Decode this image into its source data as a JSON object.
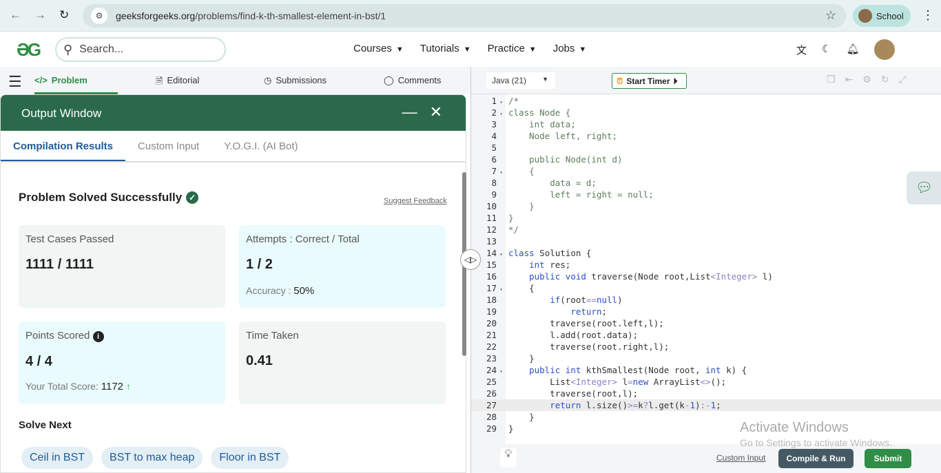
{
  "browser": {
    "url_domain": "geeksforgeeks.org",
    "url_path": "/problems/find-k-th-smallest-element-in-bst/1",
    "profile": "School"
  },
  "site": {
    "logo": "GfG",
    "search_placeholder": "Search...",
    "nav": [
      "Courses",
      "Tutorials",
      "Practice",
      "Jobs"
    ]
  },
  "left_tabs": [
    "Problem",
    "Editorial",
    "Submissions",
    "Comments"
  ],
  "output": {
    "title": "Output Window",
    "tabs": [
      "Compilation Results",
      "Custom Input",
      "Y.O.G.I. (AI Bot)"
    ],
    "status": "Problem Solved Successfully",
    "suggest": "Suggest Feedback",
    "test_label": "Test Cases Passed",
    "test_value": "1111 / 1111",
    "attempts_label": "Attempts : Correct / Total",
    "attempts_value": "1 / 2",
    "accuracy_label": "Accuracy :",
    "accuracy_value": "50%",
    "points_label": "Points Scored",
    "points_value": "4 / 4",
    "total_label": "Your Total Score:",
    "total_value": "1172",
    "time_label": "Time Taken",
    "time_value": "0.41",
    "solve_next": "Solve Next",
    "next": [
      "Ceil in BST",
      "BST to max heap",
      "Floor in BST"
    ]
  },
  "editor": {
    "language": "Java (21)",
    "timer": "Start Timer",
    "current_line": 27,
    "folds": [
      1,
      2,
      7,
      14,
      17,
      24
    ],
    "lines": [
      [
        [
          "cm",
          "/*"
        ]
      ],
      [
        [
          "cm",
          "class Node {"
        ]
      ],
      [
        [
          "cm",
          "    int data;"
        ]
      ],
      [
        [
          "cm",
          "    Node left, right;"
        ]
      ],
      [],
      [
        [
          "cm",
          "    public Node(int d)"
        ]
      ],
      [
        [
          "cm",
          "    {"
        ]
      ],
      [
        [
          "cm",
          "        data = d;"
        ]
      ],
      [
        [
          "cm",
          "        left = right = null;"
        ]
      ],
      [
        [
          "cm",
          "    }"
        ]
      ],
      [
        [
          "cm",
          "}"
        ]
      ],
      [
        [
          "cm",
          "*/"
        ]
      ],
      [],
      [
        [
          "kw",
          "class"
        ],
        [
          "pl",
          " Solution {"
        ]
      ],
      [
        [
          "pl",
          "    "
        ],
        [
          "kw",
          "int"
        ],
        [
          "pl",
          " res;"
        ]
      ],
      [
        [
          "pl",
          "    "
        ],
        [
          "kw",
          "public void"
        ],
        [
          "pl",
          " traverse(Node root,List"
        ],
        [
          "op",
          "<Integer>"
        ],
        [
          "pl",
          " l)"
        ]
      ],
      [
        [
          "pl",
          "    {"
        ]
      ],
      [
        [
          "pl",
          "        "
        ],
        [
          "kw",
          "if"
        ],
        [
          "pl",
          "(root"
        ],
        [
          "op",
          "=="
        ],
        [
          "kw",
          "null"
        ],
        [
          "pl",
          ")"
        ]
      ],
      [
        [
          "pl",
          "            "
        ],
        [
          "kw",
          "return"
        ],
        [
          "pl",
          ";"
        ]
      ],
      [
        [
          "pl",
          "        traverse(root.left,l);"
        ]
      ],
      [
        [
          "pl",
          "        l.add(root.data);"
        ]
      ],
      [
        [
          "pl",
          "        traverse(root.right,l);"
        ]
      ],
      [
        [
          "pl",
          "    }"
        ]
      ],
      [
        [
          "pl",
          "    "
        ],
        [
          "kw",
          "public int"
        ],
        [
          "pl",
          " kthSmallest(Node root, "
        ],
        [
          "kw",
          "int"
        ],
        [
          "pl",
          " k) {"
        ]
      ],
      [
        [
          "pl",
          "        List"
        ],
        [
          "op",
          "<Integer>"
        ],
        [
          "pl",
          " l"
        ],
        [
          "op",
          "="
        ],
        [
          "kw",
          "new"
        ],
        [
          "pl",
          " ArrayList"
        ],
        [
          "op",
          "<>"
        ],
        [
          "pl",
          "();"
        ]
      ],
      [
        [
          "pl",
          "        traverse(root,l);"
        ]
      ],
      [
        [
          "pl",
          "        "
        ],
        [
          "kw",
          "return"
        ],
        [
          "pl",
          " l.size()"
        ],
        [
          "op",
          ">="
        ],
        [
          "pl",
          "k"
        ],
        [
          "op",
          "?"
        ],
        [
          "pl",
          "l.get(k"
        ],
        [
          "op",
          "-"
        ],
        [
          "kw",
          "1"
        ],
        [
          "pl",
          ")"
        ],
        [
          "op",
          ":-"
        ],
        [
          "kw",
          "1"
        ],
        [
          "pl",
          ";"
        ]
      ],
      [
        [
          "pl",
          "    }"
        ]
      ],
      [
        [
          "pl",
          "}"
        ]
      ]
    ],
    "custom_input": "Custom Input",
    "compile": "Compile & Run",
    "submit": "Submit"
  },
  "watermark": {
    "title": "Activate Windows",
    "sub": "Go to Settings to activate Windows."
  }
}
